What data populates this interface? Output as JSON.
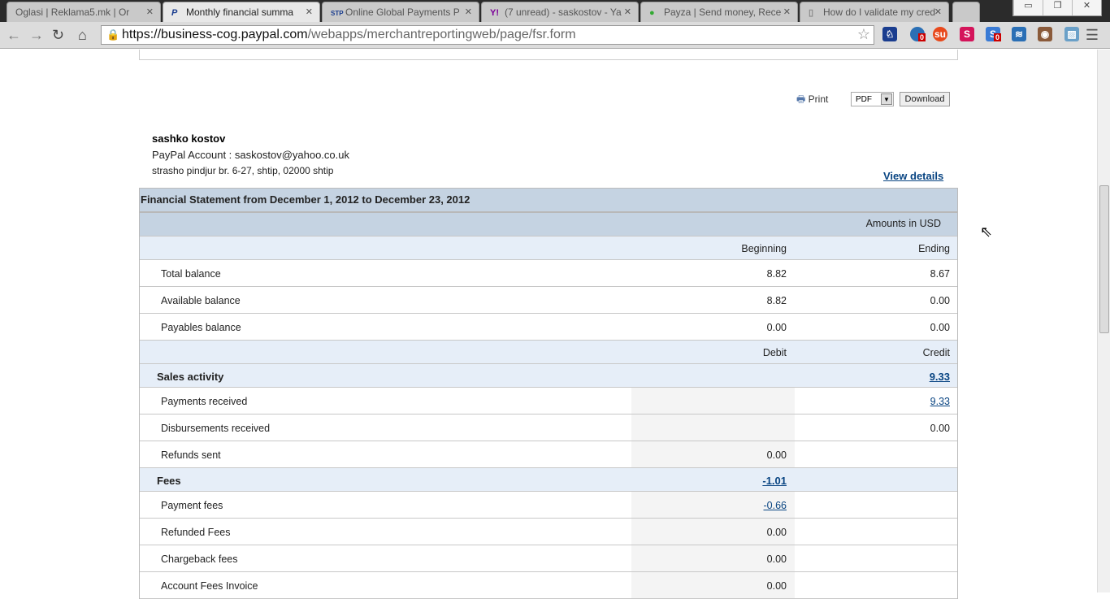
{
  "browser": {
    "tabs": [
      {
        "label": "Oglasi | Reklama5.mk | Or",
        "icon": ""
      },
      {
        "label": "Monthly financial summa",
        "icon": "P"
      },
      {
        "label": "Online Global Payments P",
        "icon": "STP"
      },
      {
        "label": "(7 unread) - saskostov - Ya",
        "icon": "Y!"
      },
      {
        "label": "Payza | Send money, Rece",
        "icon": "P"
      },
      {
        "label": "How do I validate my cred",
        "icon": "doc"
      }
    ],
    "url_host": "https://business-cog.paypal.com",
    "url_path": "/webapps/merchantreportingweb/page/fsr.form",
    "badges": [
      "0",
      "0"
    ]
  },
  "actions": {
    "print": "Print",
    "format": "PDF",
    "download": "Download"
  },
  "account": {
    "name": "sashko kostov",
    "paypal_account": "PayPal Account : saskostov@yahoo.co.uk",
    "address": "strasho pindjur br. 6-27, shtip, 02000 shtip",
    "view_details": "View details"
  },
  "statement": {
    "title": "Financial Statement from December 1, 2012 to December 23, 2012",
    "currency_note": "Amounts in USD",
    "rows": [
      {
        "type": "head",
        "c1": "Beginning",
        "c2": "Ending"
      },
      {
        "type": "row",
        "label": "Total balance",
        "c1": "8.82",
        "c2": "8.67"
      },
      {
        "type": "row",
        "label": "Available balance",
        "c1": "8.82",
        "c2": "0.00"
      },
      {
        "type": "row",
        "label": "Payables balance",
        "c1": "0.00",
        "c2": "0.00"
      },
      {
        "type": "head",
        "c1": "Debit",
        "c2": "Credit"
      },
      {
        "type": "sec",
        "label": "Sales activity",
        "c1": "",
        "c2": "9.33",
        "link": "c2"
      },
      {
        "type": "row",
        "label": "Payments received",
        "c1": "",
        "c2": "9.33",
        "link": "c2",
        "gray": true
      },
      {
        "type": "row",
        "label": "Disbursements received",
        "c1": "",
        "c2": "0.00",
        "gray": true
      },
      {
        "type": "row",
        "label": "Refunds sent",
        "c1": "0.00",
        "c2": "",
        "gray": true
      },
      {
        "type": "sec",
        "label": "Fees",
        "c1": "-1.01",
        "c2": "",
        "link": "c1"
      },
      {
        "type": "row",
        "label": "Payment fees",
        "c1": "-0.66",
        "c2": "",
        "link": "c1",
        "gray": true
      },
      {
        "type": "row",
        "label": "Refunded Fees",
        "c1": "0.00",
        "c2": "",
        "gray": true
      },
      {
        "type": "row",
        "label": "Chargeback fees",
        "c1": "0.00",
        "c2": "",
        "gray": true
      },
      {
        "type": "row",
        "label": "Account Fees Invoice",
        "c1": "0.00",
        "c2": "",
        "gray": true
      }
    ]
  },
  "colors": {
    "header": "#c5d3e2",
    "subheader": "#e6eef8",
    "link": "#084482"
  }
}
